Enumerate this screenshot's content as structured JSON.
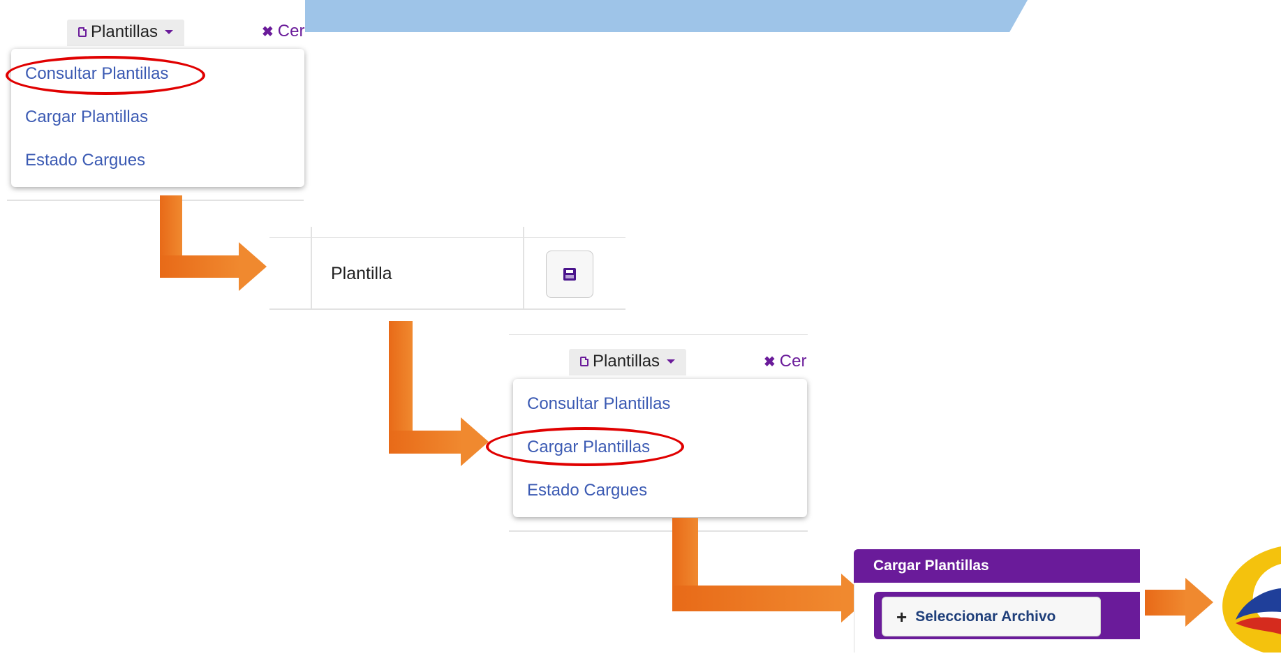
{
  "toolbar_1": {
    "templates_label": "Plantillas",
    "close_label": "Cer"
  },
  "menu_1": {
    "items": [
      "Consultar Plantillas",
      "Cargar Plantillas",
      "Estado Cargues"
    ],
    "highlighted_index": 0
  },
  "table_row": {
    "cell_label": "Plantilla"
  },
  "toolbar_2": {
    "templates_label": "Plantillas",
    "close_label": "Cer"
  },
  "menu_2": {
    "items": [
      "Consultar Plantillas",
      "Cargar Plantillas",
      "Estado Cargues"
    ],
    "highlighted_index": 1
  },
  "upload_panel": {
    "title": "Cargar Plantillas",
    "select_file_label": "Seleccionar Archivo"
  },
  "colors": {
    "banner": "#9ec4e8",
    "accent_purple": "#6a1b9a",
    "menu_link": "#3b5ab3",
    "highlight_ring": "#e00000",
    "arrow": "#f0892f"
  },
  "icons": [
    "document-icon",
    "caret-down-icon",
    "close-icon",
    "save-icon",
    "plus-icon",
    "logo-icon"
  ]
}
